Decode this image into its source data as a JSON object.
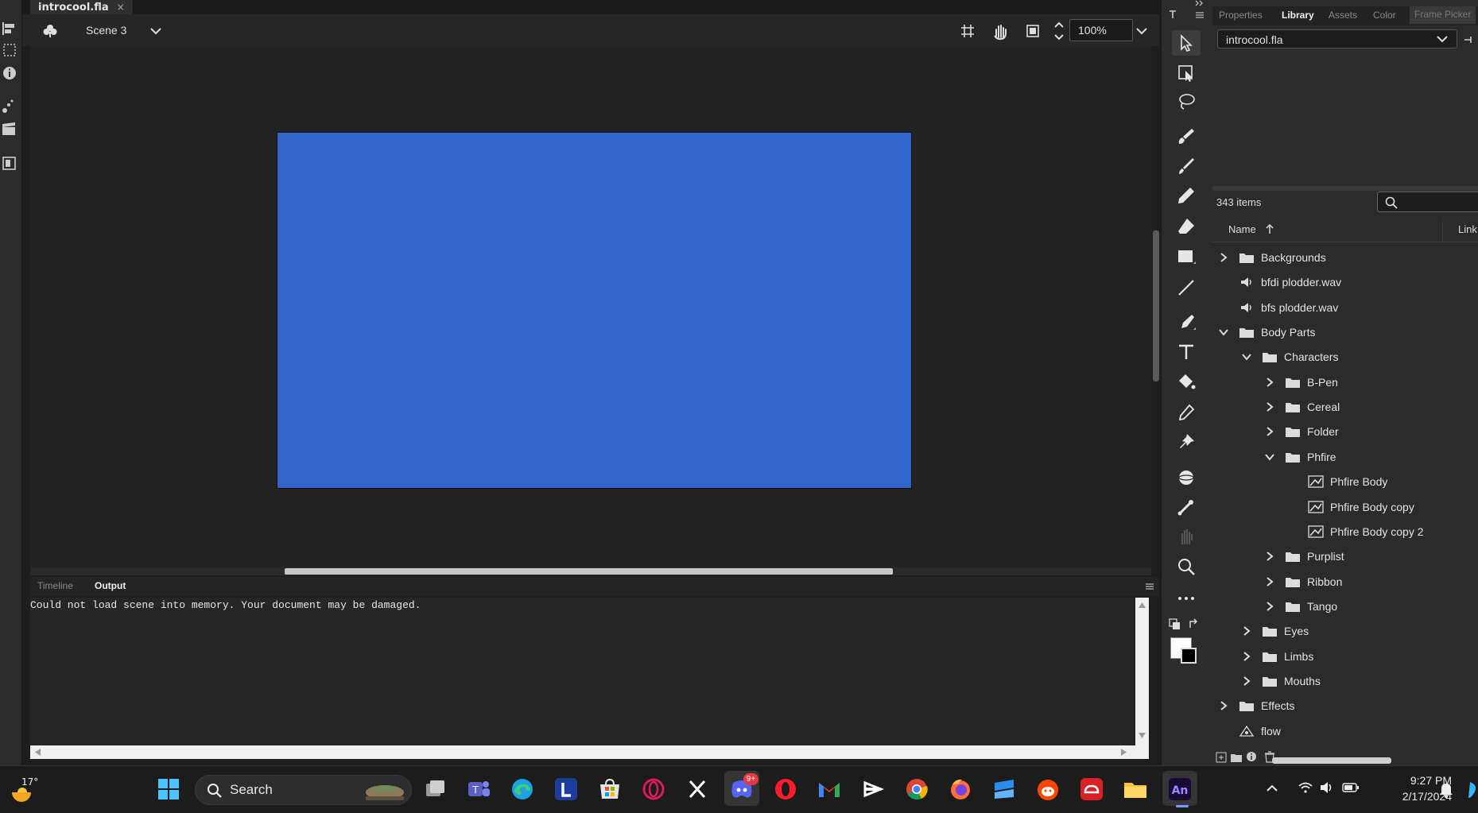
{
  "document": {
    "tab_title": "introcool.fla",
    "close_glyph": "×"
  },
  "edit_bar": {
    "scene": "Scene 3",
    "zoom": "100%"
  },
  "stage": {
    "color": "#3266cc"
  },
  "bottom_panel": {
    "tabs": [
      {
        "label": "Timeline",
        "active": false
      },
      {
        "label": "Output",
        "active": true
      }
    ],
    "output_message": "Could not load scene into memory. Your document may be damaged."
  },
  "right_panel": {
    "tabs": [
      {
        "label": "Properties",
        "active": false
      },
      {
        "label": "Library",
        "active": true
      },
      {
        "label": "Assets",
        "active": false
      },
      {
        "label": "Color",
        "active": false
      },
      {
        "label": "Frame Picker",
        "active": false
      }
    ],
    "library_document": "introcool.fla",
    "item_count": "343 items",
    "columns": {
      "name": "Name",
      "linkage": "Link"
    },
    "items": [
      {
        "label": "Backgrounds",
        "type": "folder",
        "expanded": false,
        "depth": 0
      },
      {
        "label": "bfdi plodder.wav",
        "type": "sound",
        "depth": 0
      },
      {
        "label": "bfs plodder.wav",
        "type": "sound",
        "depth": 0
      },
      {
        "label": "Body Parts",
        "type": "folder",
        "expanded": true,
        "depth": 0
      },
      {
        "label": "Characters",
        "type": "folder",
        "expanded": true,
        "depth": 1
      },
      {
        "label": "B-Pen",
        "type": "folder",
        "expanded": false,
        "depth": 2
      },
      {
        "label": "Cereal",
        "type": "folder",
        "expanded": false,
        "depth": 2
      },
      {
        "label": "Folder",
        "type": "folder",
        "expanded": false,
        "depth": 2
      },
      {
        "label": "Phfire",
        "type": "folder",
        "expanded": true,
        "depth": 2
      },
      {
        "label": "Phfire Body",
        "type": "graphic",
        "depth": 3
      },
      {
        "label": "Phfire Body copy",
        "type": "graphic",
        "depth": 3
      },
      {
        "label": "Phfire Body copy 2",
        "type": "graphic",
        "depth": 3
      },
      {
        "label": "Purplist",
        "type": "folder",
        "expanded": false,
        "depth": 2
      },
      {
        "label": "Ribbon",
        "type": "folder",
        "expanded": false,
        "depth": 2
      },
      {
        "label": "Tango",
        "type": "folder",
        "expanded": false,
        "depth": 2
      },
      {
        "label": "Eyes",
        "type": "folder",
        "expanded": false,
        "depth": 1
      },
      {
        "label": "Limbs",
        "type": "folder",
        "expanded": false,
        "depth": 1
      },
      {
        "label": "Mouths",
        "type": "folder",
        "expanded": false,
        "depth": 1
      },
      {
        "label": "Effects",
        "type": "folder",
        "expanded": false,
        "depth": 0
      },
      {
        "label": "flow",
        "type": "motion",
        "depth": 0
      }
    ]
  },
  "taskbar": {
    "weather": "17°",
    "search_placeholder": "Search",
    "discord_badge": "9+",
    "time": "9:27 PM",
    "date": "2/17/2024",
    "pinned_apps": [
      "start-icon",
      "task-view-icon",
      "teams-icon",
      "edge-icon",
      "l-app-icon",
      "store-icon",
      "opera-gx-icon",
      "x-icon",
      "discord-icon",
      "opera-icon",
      "gmail-icon",
      "capcut-icon",
      "chrome-icon",
      "firefox-icon",
      "app-icon",
      "reddit-icon",
      "creative-cloud-icon",
      "file-explorer-icon",
      "animate-icon"
    ]
  }
}
